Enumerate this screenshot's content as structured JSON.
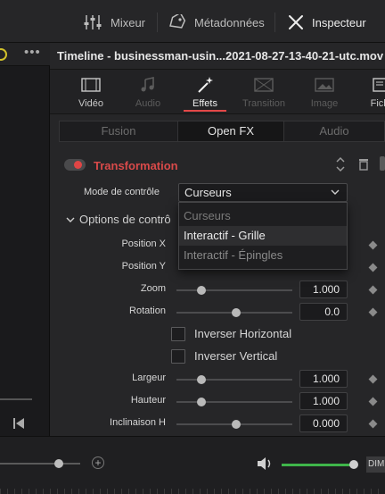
{
  "toolbar": {
    "mixer_label": "Mixeur",
    "metadata_label": "Métadonnées",
    "inspector_label": "Inspecteur"
  },
  "clip": {
    "title": "Timeline - businessman-usin...2021-08-27-13-40-21-utc.mov"
  },
  "tabs": [
    {
      "label": "Vidéo",
      "icon": "film-icon",
      "state": "normal"
    },
    {
      "label": "Audio",
      "icon": "music-note-icon",
      "state": "disabled"
    },
    {
      "label": "Effets",
      "icon": "magic-wand-icon",
      "state": "active"
    },
    {
      "label": "Transition",
      "icon": "transition-icon",
      "state": "disabled"
    },
    {
      "label": "Image",
      "icon": "image-icon",
      "state": "disabled"
    },
    {
      "label": "Fich",
      "icon": "file-icon",
      "state": "normal"
    }
  ],
  "segments": {
    "fusion": "Fusion",
    "openfx": "Open FX",
    "audio": "Audio",
    "selected": "Open FX"
  },
  "section": {
    "title": "Transformation",
    "enabled": true,
    "accent": "#d94a4a"
  },
  "mode": {
    "label": "Mode de contrôle",
    "value": "Curseurs"
  },
  "dropdown": {
    "options": [
      "Curseurs",
      "Interactif - Grille",
      "Interactif - Épingles"
    ],
    "highlighted": "Interactif - Grille"
  },
  "options_header": "Options de contrô",
  "params": {
    "position_x": {
      "label": "Position X"
    },
    "position_y": {
      "label": "Position Y"
    },
    "zoom": {
      "label": "Zoom",
      "value": "1.000"
    },
    "rotation": {
      "label": "Rotation",
      "value": "0.0"
    },
    "largeur": {
      "label": "Largeur",
      "value": "1.000"
    },
    "hauteur": {
      "label": "Hauteur",
      "value": "1.000"
    },
    "inclinaison_h": {
      "label": "Inclinaison H",
      "value": "0.000"
    }
  },
  "checks": {
    "flip_h": {
      "label": "Inverser Horizontal",
      "checked": false
    },
    "flip_v": {
      "label": "Inverser Vertical",
      "checked": false
    }
  },
  "bottom": {
    "dim_label": "DIM",
    "volume_color": "#3fb54a"
  }
}
